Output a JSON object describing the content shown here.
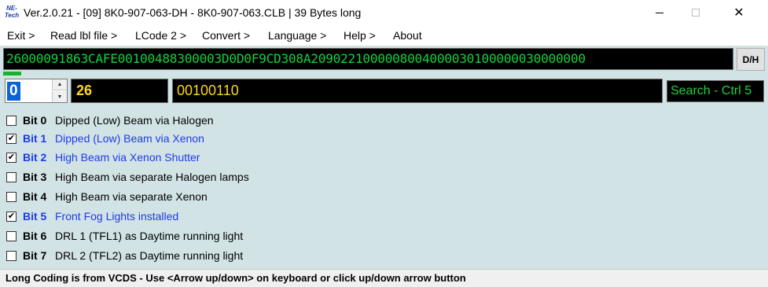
{
  "window": {
    "logo_text": "NE-Tech",
    "title": "Ver.2.0.21 - [09] 8K0-907-063-DH - 8K0-907-063.CLB | 39 Bytes long",
    "minimize_label": "",
    "maximize_label": "",
    "close_label": "✕"
  },
  "menu": [
    {
      "label": "Exit >"
    },
    {
      "label": "Read lbl file >"
    },
    {
      "label": "LCode 2 >"
    },
    {
      "label": "Convert >"
    },
    {
      "label": "Language >"
    },
    {
      "label": "Help >"
    },
    {
      "label": "About"
    }
  ],
  "coding": {
    "value": "26000091863CAFE00100488300003D0D0F9CD308A2090221000008004000030100000030000000",
    "dh_button_label": "D/H",
    "progress_percent": 2.5
  },
  "byte_selector": {
    "index": "0",
    "hex": "26",
    "binary": "00100110",
    "search_label": "Search - Ctrl 5"
  },
  "bits": [
    {
      "label": "Bit 0",
      "description": "Dipped (Low) Beam via Halogen",
      "checked": false
    },
    {
      "label": "Bit 1",
      "description": "Dipped (Low) Beam via  Xenon",
      "checked": true
    },
    {
      "label": "Bit 2",
      "description": "High Beam via Xenon Shutter",
      "checked": true
    },
    {
      "label": "Bit 3",
      "description": "High Beam via separate Halogen lamps",
      "checked": false
    },
    {
      "label": "Bit 4",
      "description": "High Beam via separate Xenon",
      "checked": false
    },
    {
      "label": "Bit 5",
      "description": "Front Fog Lights installed",
      "checked": true
    },
    {
      "label": "Bit 6",
      "description": "DRL 1 (TFL1) as Daytime running light",
      "checked": false
    },
    {
      "label": "Bit 7",
      "description": "DRL 2 (TFL2) as Daytime running light",
      "checked": false
    }
  ],
  "status": {
    "text": "Long Coding is from VCDS - Use <Arrow up/down> on keyboard or click up/down arrow button"
  },
  "colors": {
    "panel_bg": "#d2e3e6",
    "coding_text": "#11d23c",
    "hex_text": "#ffd51e",
    "checked_text": "#1f3be6",
    "selection_bg": "#0a64d8"
  }
}
